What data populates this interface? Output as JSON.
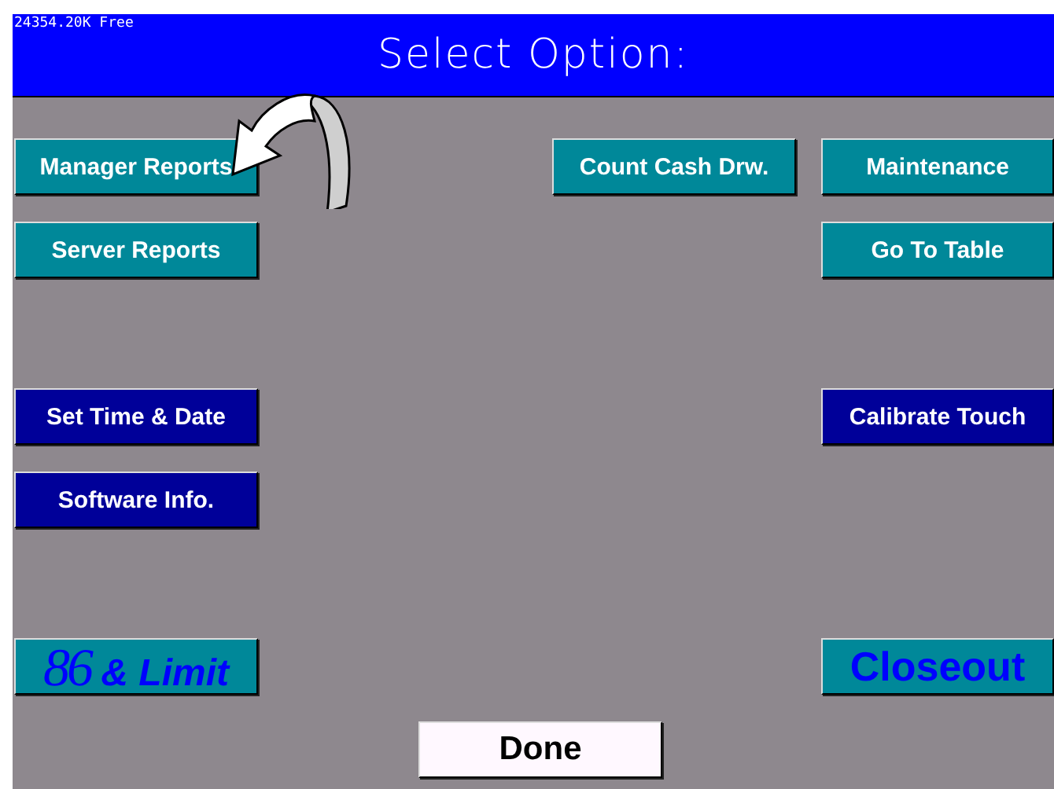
{
  "header": {
    "memory": "24354.20K Free",
    "title": "Select Option:"
  },
  "left_buttons": [
    {
      "label": "Manager Reports",
      "kind": "teal"
    },
    {
      "label": "Server Reports",
      "kind": "teal"
    },
    {
      "label": "Set Time & Date",
      "kind": "navy"
    },
    {
      "label": "Software Info.",
      "kind": "navy"
    },
    {
      "label": "& Limit",
      "big": "86",
      "kind": "logo"
    }
  ],
  "center_buttons": [
    {
      "label": "Count Cash Drw.",
      "kind": "teal"
    }
  ],
  "right_buttons": [
    {
      "label": "Maintenance",
      "kind": "teal"
    },
    {
      "label": "Go To Table",
      "kind": "teal"
    },
    {
      "label": "Calibrate Touch",
      "kind": "navy"
    },
    {
      "label": "Closeout",
      "kind": "logo"
    }
  ],
  "done_button": {
    "label": "Done"
  }
}
